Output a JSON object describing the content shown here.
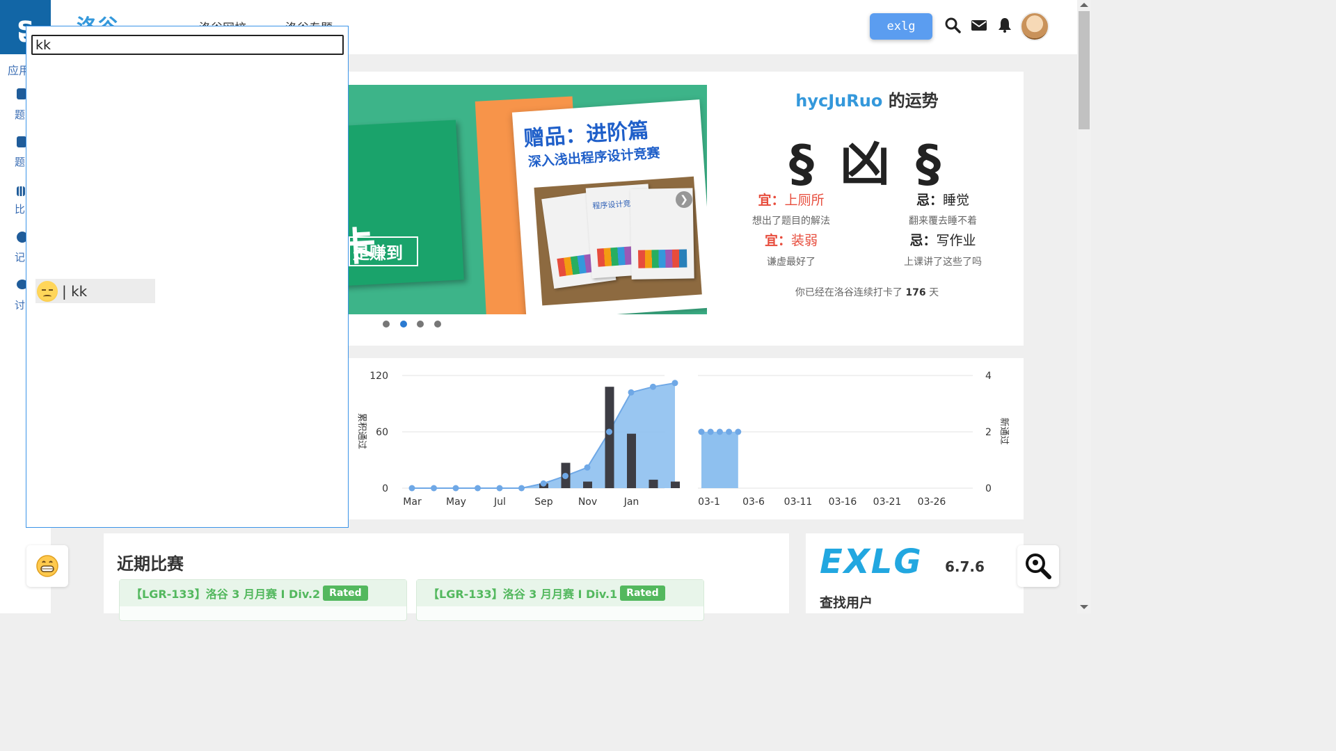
{
  "nav": {
    "brand": "洛谷",
    "links": [
      "洛谷网校",
      "洛谷专题"
    ],
    "exlg_button": "exlg"
  },
  "sidebar": {
    "logo": "ʂ",
    "section": "应用",
    "items": [
      "题",
      "题",
      "比",
      "记",
      "讨"
    ]
  },
  "banner": {
    "card_text": "卡",
    "card_sub": "是赚到",
    "paper_title": "赠品：进阶篇",
    "paper_sub": "深入浅出程序设计竞赛",
    "book_label": "程序设计竞赛",
    "dots": 4,
    "active_dot": 1
  },
  "fortune": {
    "username": "hycJuRuo",
    "suffix": "的运势",
    "result": "§ 凶 §",
    "items": [
      {
        "key": "宜：",
        "value": "上厕所",
        "desc": "想出了题目的解法",
        "kind": "good"
      },
      {
        "key": "忌：",
        "value": "睡觉",
        "desc": "翻来覆去睡不着",
        "kind": "bad"
      },
      {
        "key": "宜：",
        "value": "装弱",
        "desc": "谦虚最好了",
        "kind": "good"
      },
      {
        "key": "忌：",
        "value": "写作业",
        "desc": "上课讲了这些了吗",
        "kind": "bad"
      }
    ],
    "checkin_prefix": "你已经在洛谷连续打卡了",
    "checkin_days": "176",
    "checkin_suffix": "天"
  },
  "chart_data": [
    {
      "type": "bar",
      "ylabel": "累积通过",
      "ylim": [
        0,
        120
      ],
      "yticks": [
        0,
        60,
        120
      ],
      "x": [
        "Feb",
        "Mar",
        "Apr",
        "May",
        "Jun",
        "Jul",
        "Aug",
        "Sep",
        "Oct",
        "Nov",
        "Dec",
        "Jan",
        "Feb"
      ],
      "xtick_labels": [
        "Mar",
        "May",
        "Jul",
        "Sep",
        "Nov",
        "Jan"
      ],
      "series": [
        {
          "kind": "bar",
          "values": [
            0,
            0,
            0,
            0,
            0,
            0,
            5,
            27,
            7,
            108,
            58,
            9,
            7
          ]
        },
        {
          "kind": "area",
          "values": [
            0,
            0,
            0,
            0,
            0,
            0,
            5,
            13,
            22,
            60,
            102,
            108,
            112
          ]
        }
      ]
    },
    {
      "type": "area",
      "ylabel": "新通过",
      "ylim": [
        0,
        4
      ],
      "yticks": [
        0,
        2,
        4
      ],
      "xtick_labels": [
        "03-1",
        "03-6",
        "03-11",
        "03-16",
        "03-21",
        "03-26"
      ],
      "x": [
        "03-1",
        "03-2",
        "03-3",
        "03-4",
        "03-5"
      ],
      "values": [
        2,
        2,
        2,
        2,
        2
      ]
    }
  ],
  "contests": {
    "title": "近期比赛",
    "items": [
      {
        "name": "【LGR-133】洛谷 3 月月赛 I Div.2",
        "badge": "Rated"
      },
      {
        "name": "【LGR-133】洛谷 3 月月赛 I Div.1",
        "badge": "Rated"
      }
    ]
  },
  "exlg": {
    "logo": "EXLG",
    "version": "6.7.6",
    "find_user": "查找用户"
  },
  "popup": {
    "input_value": "kk",
    "result_label": "| kk"
  },
  "icons": {
    "search": "search-icon",
    "mail": "mail-icon",
    "bell": "bell-icon",
    "emoji": "emoji-icon",
    "map_search": "map-search-icon"
  },
  "colors": {
    "accent": "#3498db",
    "good": "#e74c3c",
    "rated": "#53b85e",
    "exlg": "#22a7e0",
    "bar": "#3d3d44",
    "area": "#8ec0ef"
  }
}
